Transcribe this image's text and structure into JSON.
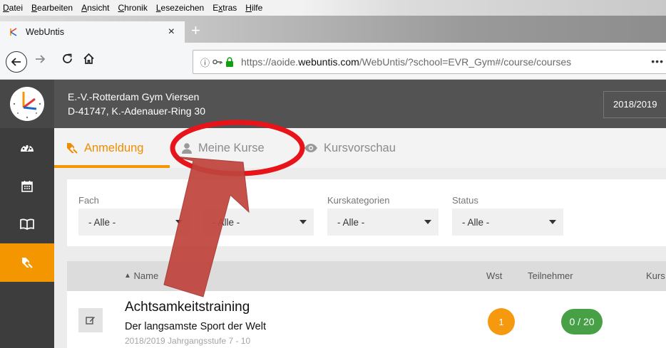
{
  "browser": {
    "menu": [
      {
        "label": "Datei",
        "underline": "D"
      },
      {
        "label": "Bearbeiten",
        "underline": "B"
      },
      {
        "label": "Ansicht",
        "underline": "A"
      },
      {
        "label": "Chronik",
        "underline": "C"
      },
      {
        "label": "Lesezeichen",
        "underline": "L"
      },
      {
        "label": "Extras",
        "underline": "x"
      },
      {
        "label": "Hilfe",
        "underline": "H"
      }
    ],
    "tab_title": "WebUntis",
    "tab_close": "×",
    "new_tab": "+",
    "url_prefix": "https://aoide.",
    "url_domain": "webuntis.com",
    "url_suffix": "/WebUntis/?school=EVR_Gym#/course/courses",
    "url_more": "•••"
  },
  "app": {
    "school_name": "E.-V.-Rotterdam Gym Viersen",
    "school_address": "D-41747, K.-Adenauer-Ring 30",
    "school_year": "2018/2019"
  },
  "sidebar": {
    "items": [
      {
        "icon": "dashboard-icon"
      },
      {
        "icon": "calendar-icon"
      },
      {
        "icon": "book-icon"
      },
      {
        "icon": "course-registration-icon",
        "active": true
      }
    ]
  },
  "subtabs": {
    "anmeldung": "Anmeldung",
    "meine_kurse": "Meine Kurse",
    "kursvorschau": "Kursvorschau"
  },
  "filters": [
    {
      "label": "Fach",
      "value": "- Alle -"
    },
    {
      "label": "",
      "value": "- Alle -"
    },
    {
      "label": "Kurskategorien",
      "value": "- Alle -"
    },
    {
      "label": "Status",
      "value": "- Alle -"
    }
  ],
  "table": {
    "headers": {
      "name": "Name",
      "wst": "Wst",
      "teilnehmer": "Teilnehmer",
      "kurs": "Kurs"
    },
    "rows": [
      {
        "title": "Achtsamkeitstraining",
        "subtitle": "Der langsamste Sport der Welt",
        "meta": "2018/2019 Jahrgangsstufe 7 - 10",
        "wst": "1",
        "teilnehmer": "0 / 20"
      }
    ]
  },
  "colors": {
    "accent": "#f49600",
    "header_bg": "#535353",
    "sidebar_bg": "#3d3d3d",
    "participants_badge": "#47a046",
    "annotation": "#e8141a",
    "arrow": "#c0443d"
  }
}
